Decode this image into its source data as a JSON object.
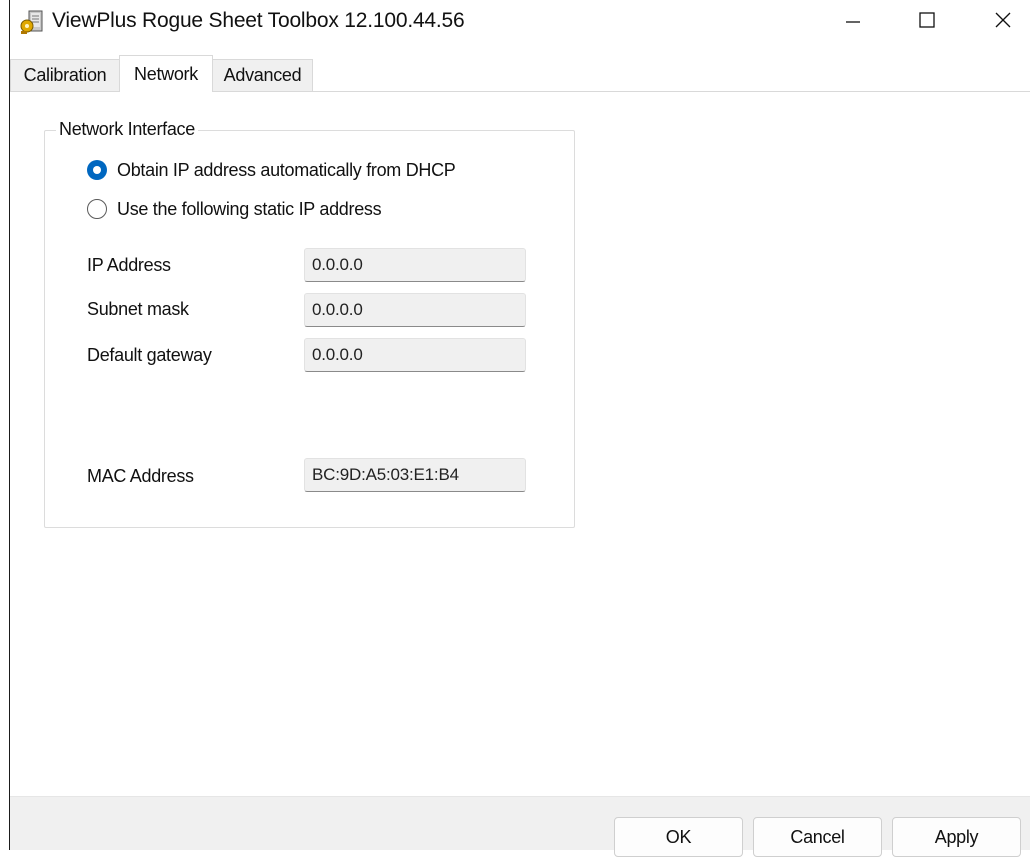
{
  "window": {
    "title": "ViewPlus Rogue Sheet Toolbox 12.100.44.56",
    "icon": "app-icon",
    "controls": {
      "minimize": "minimize-icon",
      "maximize": "maximize-icon",
      "close": "close-icon"
    }
  },
  "tabs": [
    {
      "label": "Calibration",
      "active": false
    },
    {
      "label": "Network",
      "active": true
    },
    {
      "label": "Advanced",
      "active": false
    }
  ],
  "network": {
    "group_title": "Network Interface",
    "radio_dhcp": {
      "label": "Obtain IP address automatically from DHCP",
      "checked": true
    },
    "radio_static": {
      "label": "Use the following static IP address",
      "checked": false
    },
    "ip_address": {
      "label": "IP Address",
      "value": "0.0.0.0"
    },
    "subnet_mask": {
      "label": "Subnet mask",
      "value": "0.0.0.0"
    },
    "default_gateway": {
      "label": "Default gateway",
      "value": "0.0.0.0"
    },
    "mac_address": {
      "label": "MAC Address",
      "value": "BC:9D:A5:03:E1:B4"
    }
  },
  "buttons": {
    "ok": "OK",
    "cancel": "Cancel",
    "apply": "Apply"
  },
  "colors": {
    "accent": "#0067c0",
    "field_bg": "#f0f0f0",
    "footer_bg": "#f0f0f0"
  }
}
